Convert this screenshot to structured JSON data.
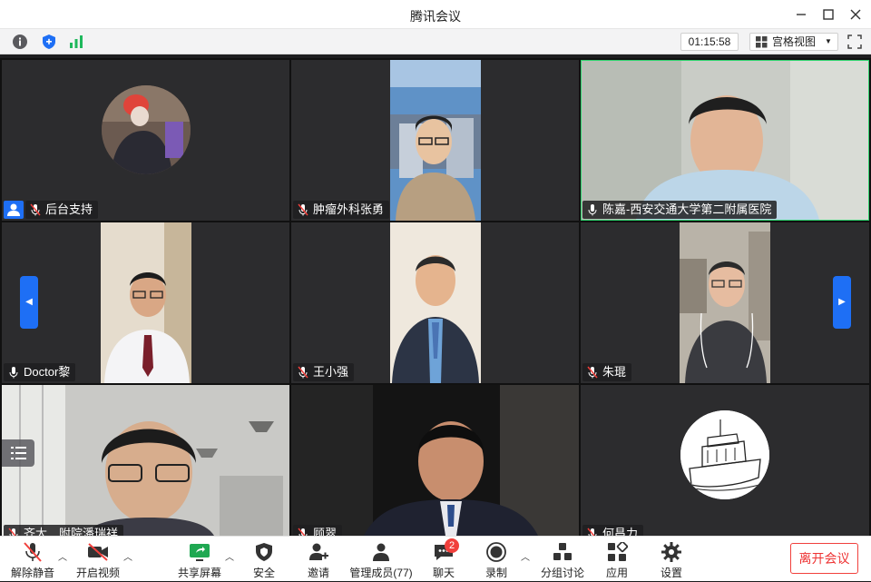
{
  "window": {
    "title": "腾讯会议",
    "minimize_icon": "minimize-icon",
    "maximize_icon": "maximize-icon",
    "close_icon": "close-icon"
  },
  "topbar": {
    "icons": [
      "info-icon",
      "shield-icon",
      "signal-icon"
    ],
    "timer": "01:15:58",
    "view_label": "宫格视图",
    "fullscreen_icon": "fullscreen-icon"
  },
  "participants": [
    {
      "name": "后台支持",
      "mic": "muted",
      "host": true,
      "video": false
    },
    {
      "name": "肿瘤外科张勇",
      "mic": "muted",
      "video": true
    },
    {
      "name": "陈嘉-西安交通大学第二附属医院",
      "mic": "on",
      "video": true,
      "speaking": true
    },
    {
      "name": "Doctor黎",
      "mic": "on",
      "video": true
    },
    {
      "name": "王小强",
      "mic": "muted",
      "video": true
    },
    {
      "name": "朱琨",
      "mic": "muted",
      "video": true
    },
    {
      "name": "齐大…附院潘瑞祥",
      "mic": "muted",
      "video": true
    },
    {
      "name": "顾翠",
      "mic": "muted",
      "video": true
    },
    {
      "name": "何昌力",
      "mic": "muted",
      "video": false
    }
  ],
  "toolbar": {
    "unmute": "解除静音",
    "start_video": "开启视频",
    "share_screen": "共享屏幕",
    "security": "安全",
    "invite": "邀请",
    "manage_members": "管理成员(77)",
    "chat": "聊天",
    "chat_badge": "2",
    "record": "录制",
    "breakout": "分组讨论",
    "apps": "应用",
    "settings": "设置",
    "leave": "离开会议"
  },
  "colors": {
    "accent": "#1e6ff5",
    "danger": "#f1403c",
    "speaking": "#2fd46e"
  }
}
